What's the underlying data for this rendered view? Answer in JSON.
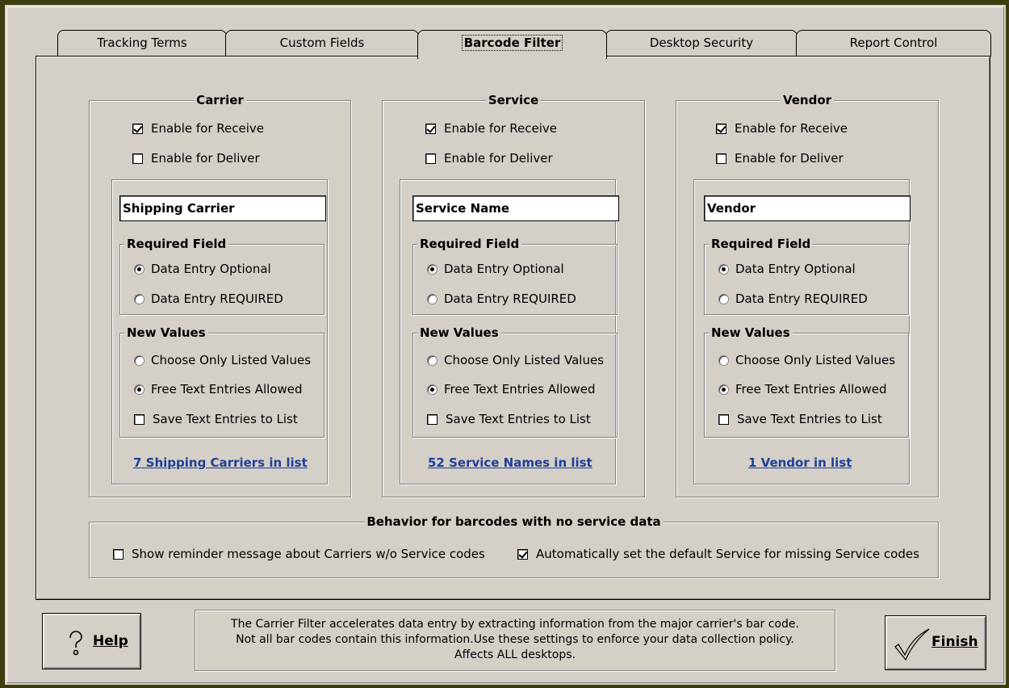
{
  "tabs": [
    {
      "label": "Tracking Terms",
      "active": false
    },
    {
      "label": "Custom Fields",
      "active": false
    },
    {
      "label": "Barcode Filter",
      "active": true
    },
    {
      "label": "Desktop Security",
      "active": false
    },
    {
      "label": "Report Control",
      "active": false
    }
  ],
  "groups": [
    {
      "title": "Carrier",
      "enable_receive": {
        "label": "Enable for Receive",
        "checked": true
      },
      "enable_deliver": {
        "label": "Enable for Deliver",
        "checked": false
      },
      "field_name": "Shipping Carrier",
      "required_title": "Required Field",
      "required_options": [
        {
          "label": "Data Entry Optional",
          "selected": true
        },
        {
          "label": "Data Entry REQUIRED",
          "selected": false
        }
      ],
      "newvalues_title": "New Values",
      "newvalues_options": [
        {
          "label": "Choose Only Listed Values",
          "selected": false
        },
        {
          "label": "Free Text Entries Allowed",
          "selected": true
        }
      ],
      "save_text": {
        "label": "Save Text Entries to List",
        "checked": false
      },
      "list_link": "7 Shipping Carriers in list"
    },
    {
      "title": "Service",
      "enable_receive": {
        "label": "Enable for Receive",
        "checked": true
      },
      "enable_deliver": {
        "label": "Enable for Deliver",
        "checked": false
      },
      "field_name": "Service Name",
      "required_title": "Required Field",
      "required_options": [
        {
          "label": "Data Entry Optional",
          "selected": true
        },
        {
          "label": "Data Entry REQUIRED",
          "selected": false
        }
      ],
      "newvalues_title": "New Values",
      "newvalues_options": [
        {
          "label": "Choose Only Listed Values",
          "selected": false
        },
        {
          "label": "Free Text Entries Allowed",
          "selected": true
        }
      ],
      "save_text": {
        "label": "Save Text Entries to List",
        "checked": false
      },
      "list_link": "52 Service Names in list"
    },
    {
      "title": "Vendor",
      "enable_receive": {
        "label": "Enable for Receive",
        "checked": true
      },
      "enable_deliver": {
        "label": "Enable for Deliver",
        "checked": false
      },
      "field_name": "Vendor",
      "required_title": "Required Field",
      "required_options": [
        {
          "label": "Data Entry Optional",
          "selected": true
        },
        {
          "label": "Data Entry REQUIRED",
          "selected": false
        }
      ],
      "newvalues_title": "New Values",
      "newvalues_options": [
        {
          "label": "Choose Only Listed Values",
          "selected": false
        },
        {
          "label": "Free Text Entries Allowed",
          "selected": true
        }
      ],
      "save_text": {
        "label": "Save Text Entries to List",
        "checked": false
      },
      "list_link": "1 Vendor in list"
    }
  ],
  "behavior": {
    "title": "Behavior for barcodes with no service data",
    "show_reminder": {
      "label": "Show reminder message about Carriers w/o Service codes",
      "checked": false
    },
    "auto_default": {
      "label": "Automatically set the default Service for missing Service codes",
      "checked": true
    }
  },
  "footer": {
    "help_label": "Help",
    "finish_label": "Finish",
    "info_lines": [
      "The Carrier Filter accelerates data entry by extracting information from the major carrier's bar code.",
      "Not all bar codes contain this information.Use these settings to enforce your data collection policy.",
      "Affects ALL desktops."
    ]
  },
  "colors": {
    "background": "#d4d0c8",
    "link": "#1f3f97",
    "frame": "#3c3c0e"
  }
}
